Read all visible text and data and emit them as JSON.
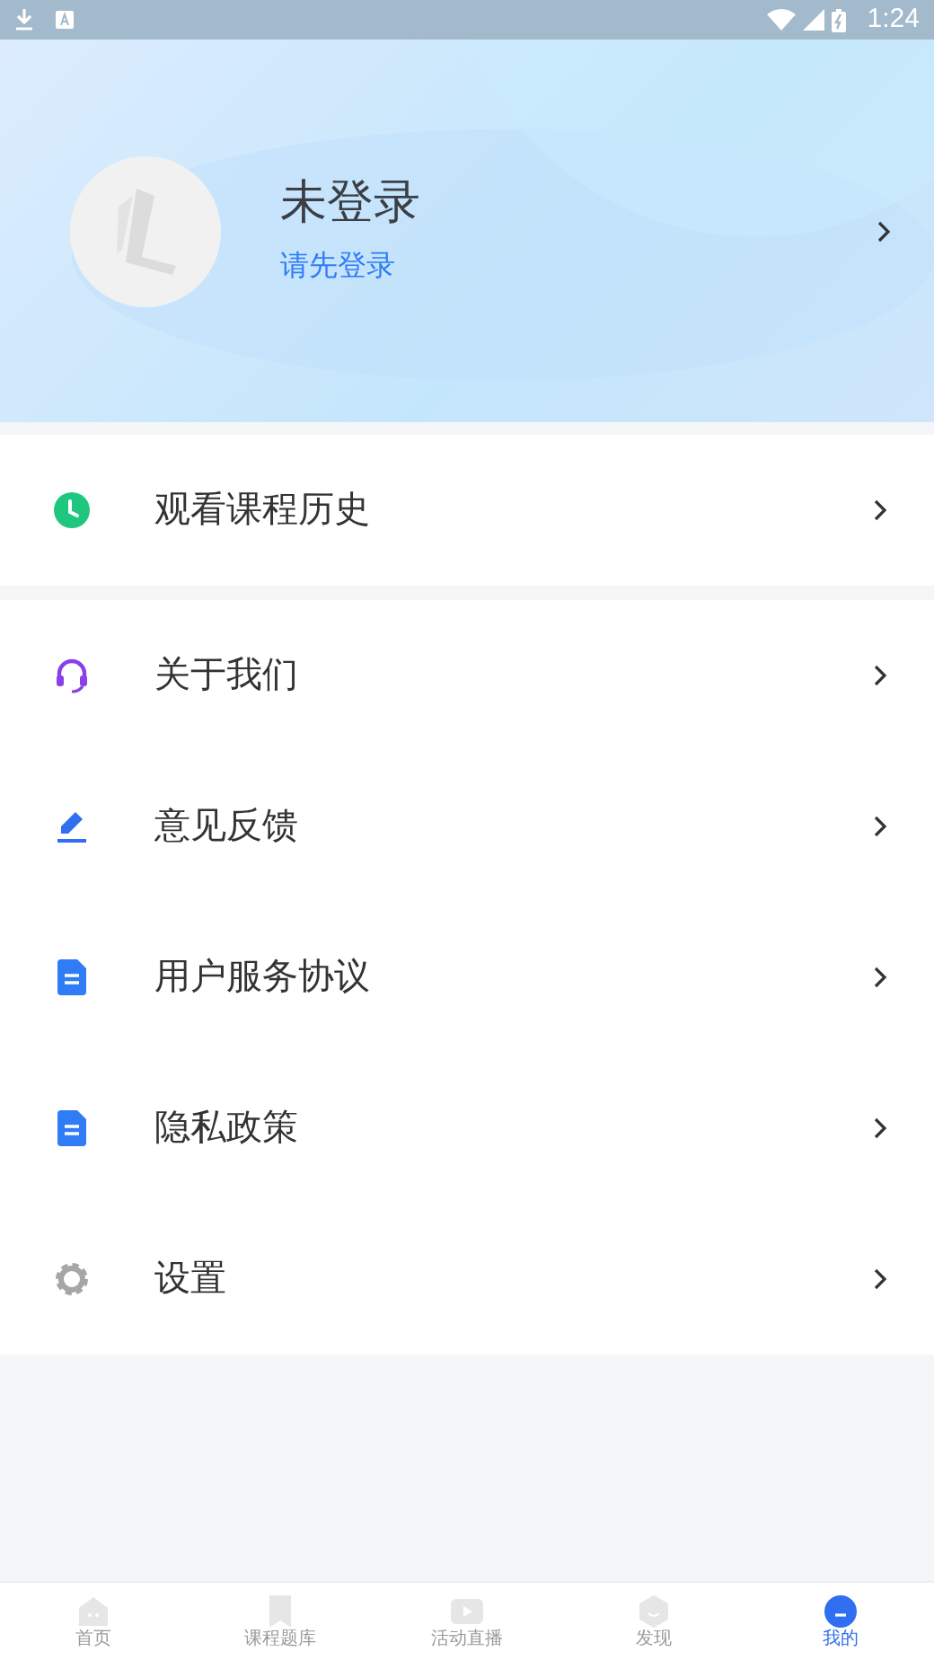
{
  "status_bar": {
    "time": "1:24"
  },
  "profile": {
    "name": "未登录",
    "login_link": "请先登录"
  },
  "menu_groups": [
    [
      {
        "kind": "history",
        "label": "观看课程历史"
      }
    ],
    [
      {
        "kind": "about",
        "label": "关于我们"
      },
      {
        "kind": "feedback",
        "label": "意见反馈"
      },
      {
        "kind": "document",
        "label": "用户服务协议"
      },
      {
        "kind": "document",
        "label": "隐私政策"
      },
      {
        "kind": "settings",
        "label": "设置"
      }
    ]
  ],
  "tab_bar": [
    {
      "kind": "home",
      "label": "首页",
      "selected": false
    },
    {
      "kind": "bank",
      "label": "课程题库",
      "selected": false
    },
    {
      "kind": "live",
      "label": "活动直播",
      "selected": false
    },
    {
      "kind": "discover",
      "label": "发现",
      "selected": false
    },
    {
      "kind": "me",
      "label": "我的",
      "selected": true
    }
  ]
}
